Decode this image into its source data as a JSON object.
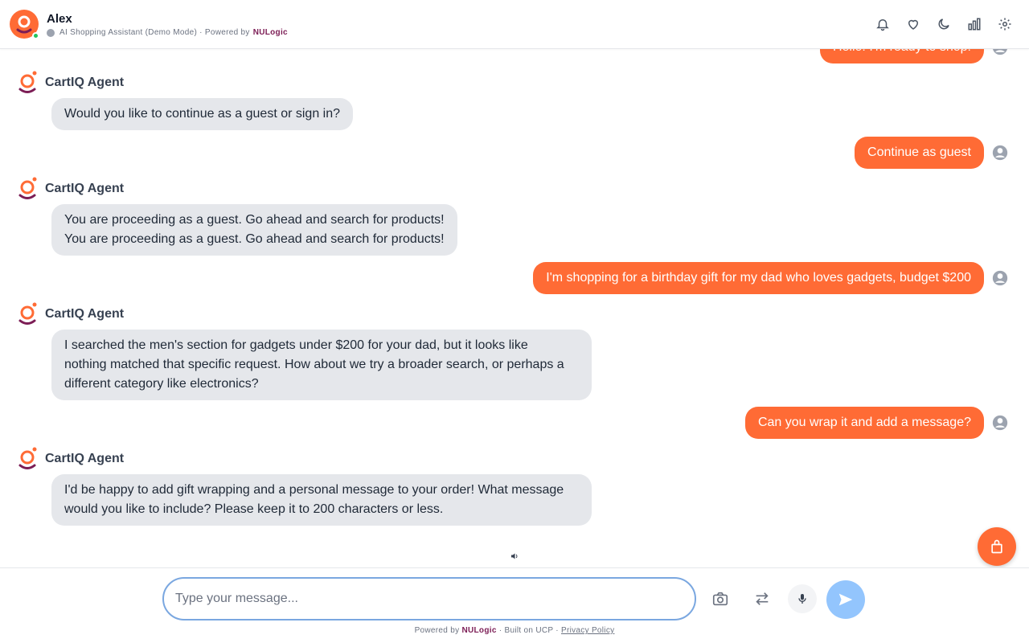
{
  "header": {
    "name": "Alex",
    "subtitle": "AI Shopping Assistant (Demo Mode) · Powered by",
    "brand": "NULogic",
    "icons": [
      "bell-icon",
      "heart-icon",
      "moon-icon",
      "bar-chart-icon",
      "gear-icon"
    ]
  },
  "colors": {
    "accent": "#ff6b35",
    "agent_bubble": "#e5e7eb",
    "brand": "#7c1d55",
    "send": "#93c5fd",
    "online": "#22c55e"
  },
  "messages": {
    "u0": "Hello! I'm ready to shop!",
    "a1_name": "CartIQ Agent",
    "a1": "Would you like to continue as a guest or sign in?",
    "u1": "Continue as guest",
    "a2_name": "CartIQ Agent",
    "a2_l1": "You are proceeding as a guest. Go ahead and search for products!",
    "a2_l2": "You are proceeding as a guest. Go ahead and search for products!",
    "u2": "I'm shopping for a birthday gift for my dad who loves gadgets, budget $200",
    "a3_name": "CartIQ Agent",
    "a3_l1": "I searched the men's section for gadgets under $200 for your dad, but it looks like",
    "a3_l2": "nothing matched that specific request. How about we try a broader search, or perhaps a",
    "a3_l3": "different category like electronics?",
    "u3": "Can you wrap it and add a message?",
    "a4_name": "CartIQ Agent",
    "a4_l1": "I'd be happy to add gift wrapping and a personal message to your order! What message",
    "a4_l2": "would you like to include? Please keep it to 200 characters or less."
  },
  "input": {
    "placeholder": "Type your message..."
  },
  "footer": {
    "powered": "Powered by",
    "brand": "NULogic",
    "built": "· Built on UCP ·",
    "privacy": "Privacy Policy"
  }
}
